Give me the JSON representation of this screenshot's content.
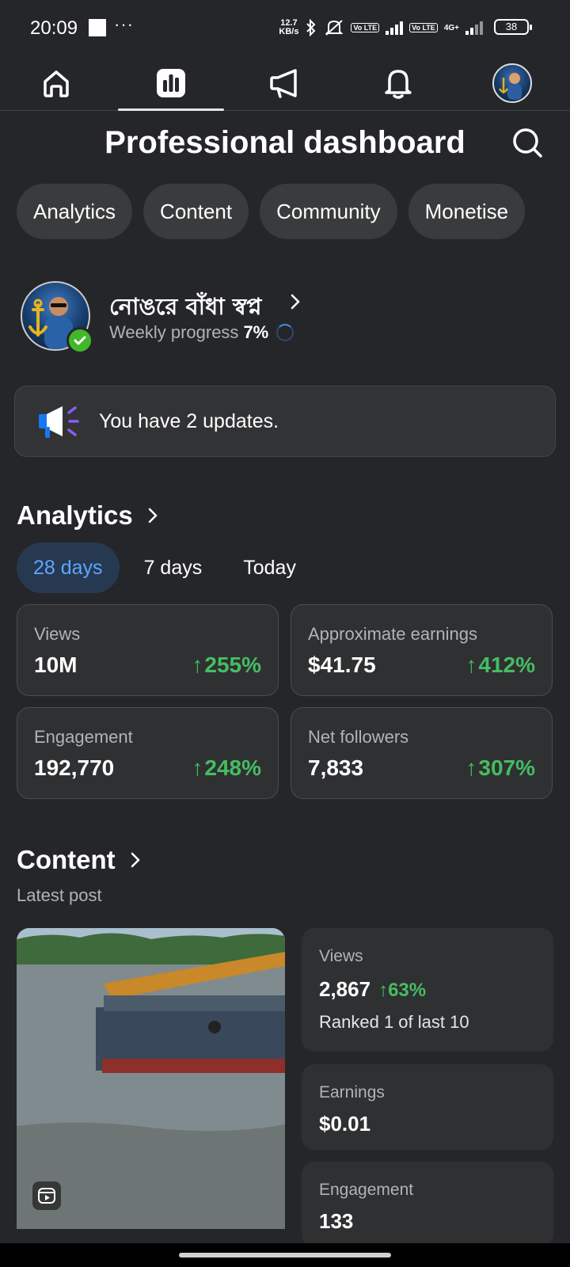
{
  "status_bar": {
    "time": "20:09",
    "dots": "···",
    "net_speed_value": "12.7",
    "net_speed_unit": "KB/s",
    "sim1": "Vo LTE",
    "sim2": "Vo LTE",
    "network_type": "4G+",
    "battery": "38"
  },
  "nav": {
    "items": [
      "home",
      "dashboard",
      "ads",
      "notifications",
      "profile"
    ],
    "active": "dashboard"
  },
  "header": {
    "title": "Professional dashboard"
  },
  "chips": [
    "Analytics",
    "Content",
    "Community",
    "Monetise"
  ],
  "profile": {
    "name": "নোঙরে বাঁধা স্বপ্ন",
    "progress_label": "Weekly progress",
    "progress_value": "7%",
    "progress_fraction": 0.07
  },
  "updates": {
    "text": "You have 2 updates."
  },
  "analytics": {
    "title": "Analytics",
    "ranges": [
      "28 days",
      "7 days",
      "Today"
    ],
    "active_range": "28 days",
    "stats": [
      {
        "label": "Views",
        "value": "10M",
        "delta": "255%"
      },
      {
        "label": "Approximate earnings",
        "value": "$41.75",
        "delta": "412%"
      },
      {
        "label": "Engagement",
        "value": "192,770",
        "delta": "248%"
      },
      {
        "label": "Net followers",
        "value": "7,833",
        "delta": "307%"
      }
    ]
  },
  "content": {
    "title": "Content",
    "subtitle": "Latest post",
    "post": {
      "views_label": "Views",
      "views_value": "2,867",
      "views_delta": "63%",
      "rank_text": "Ranked 1 of last 10",
      "earnings_label": "Earnings",
      "earnings_value": "$0.01",
      "engagement_label": "Engagement",
      "engagement_value": "133"
    }
  },
  "colors": {
    "background": "#252629",
    "card": "#2f3032",
    "chip": "#3a3b3c",
    "accent_blue": "#5ea5ff",
    "positive_green": "#45bd62"
  }
}
